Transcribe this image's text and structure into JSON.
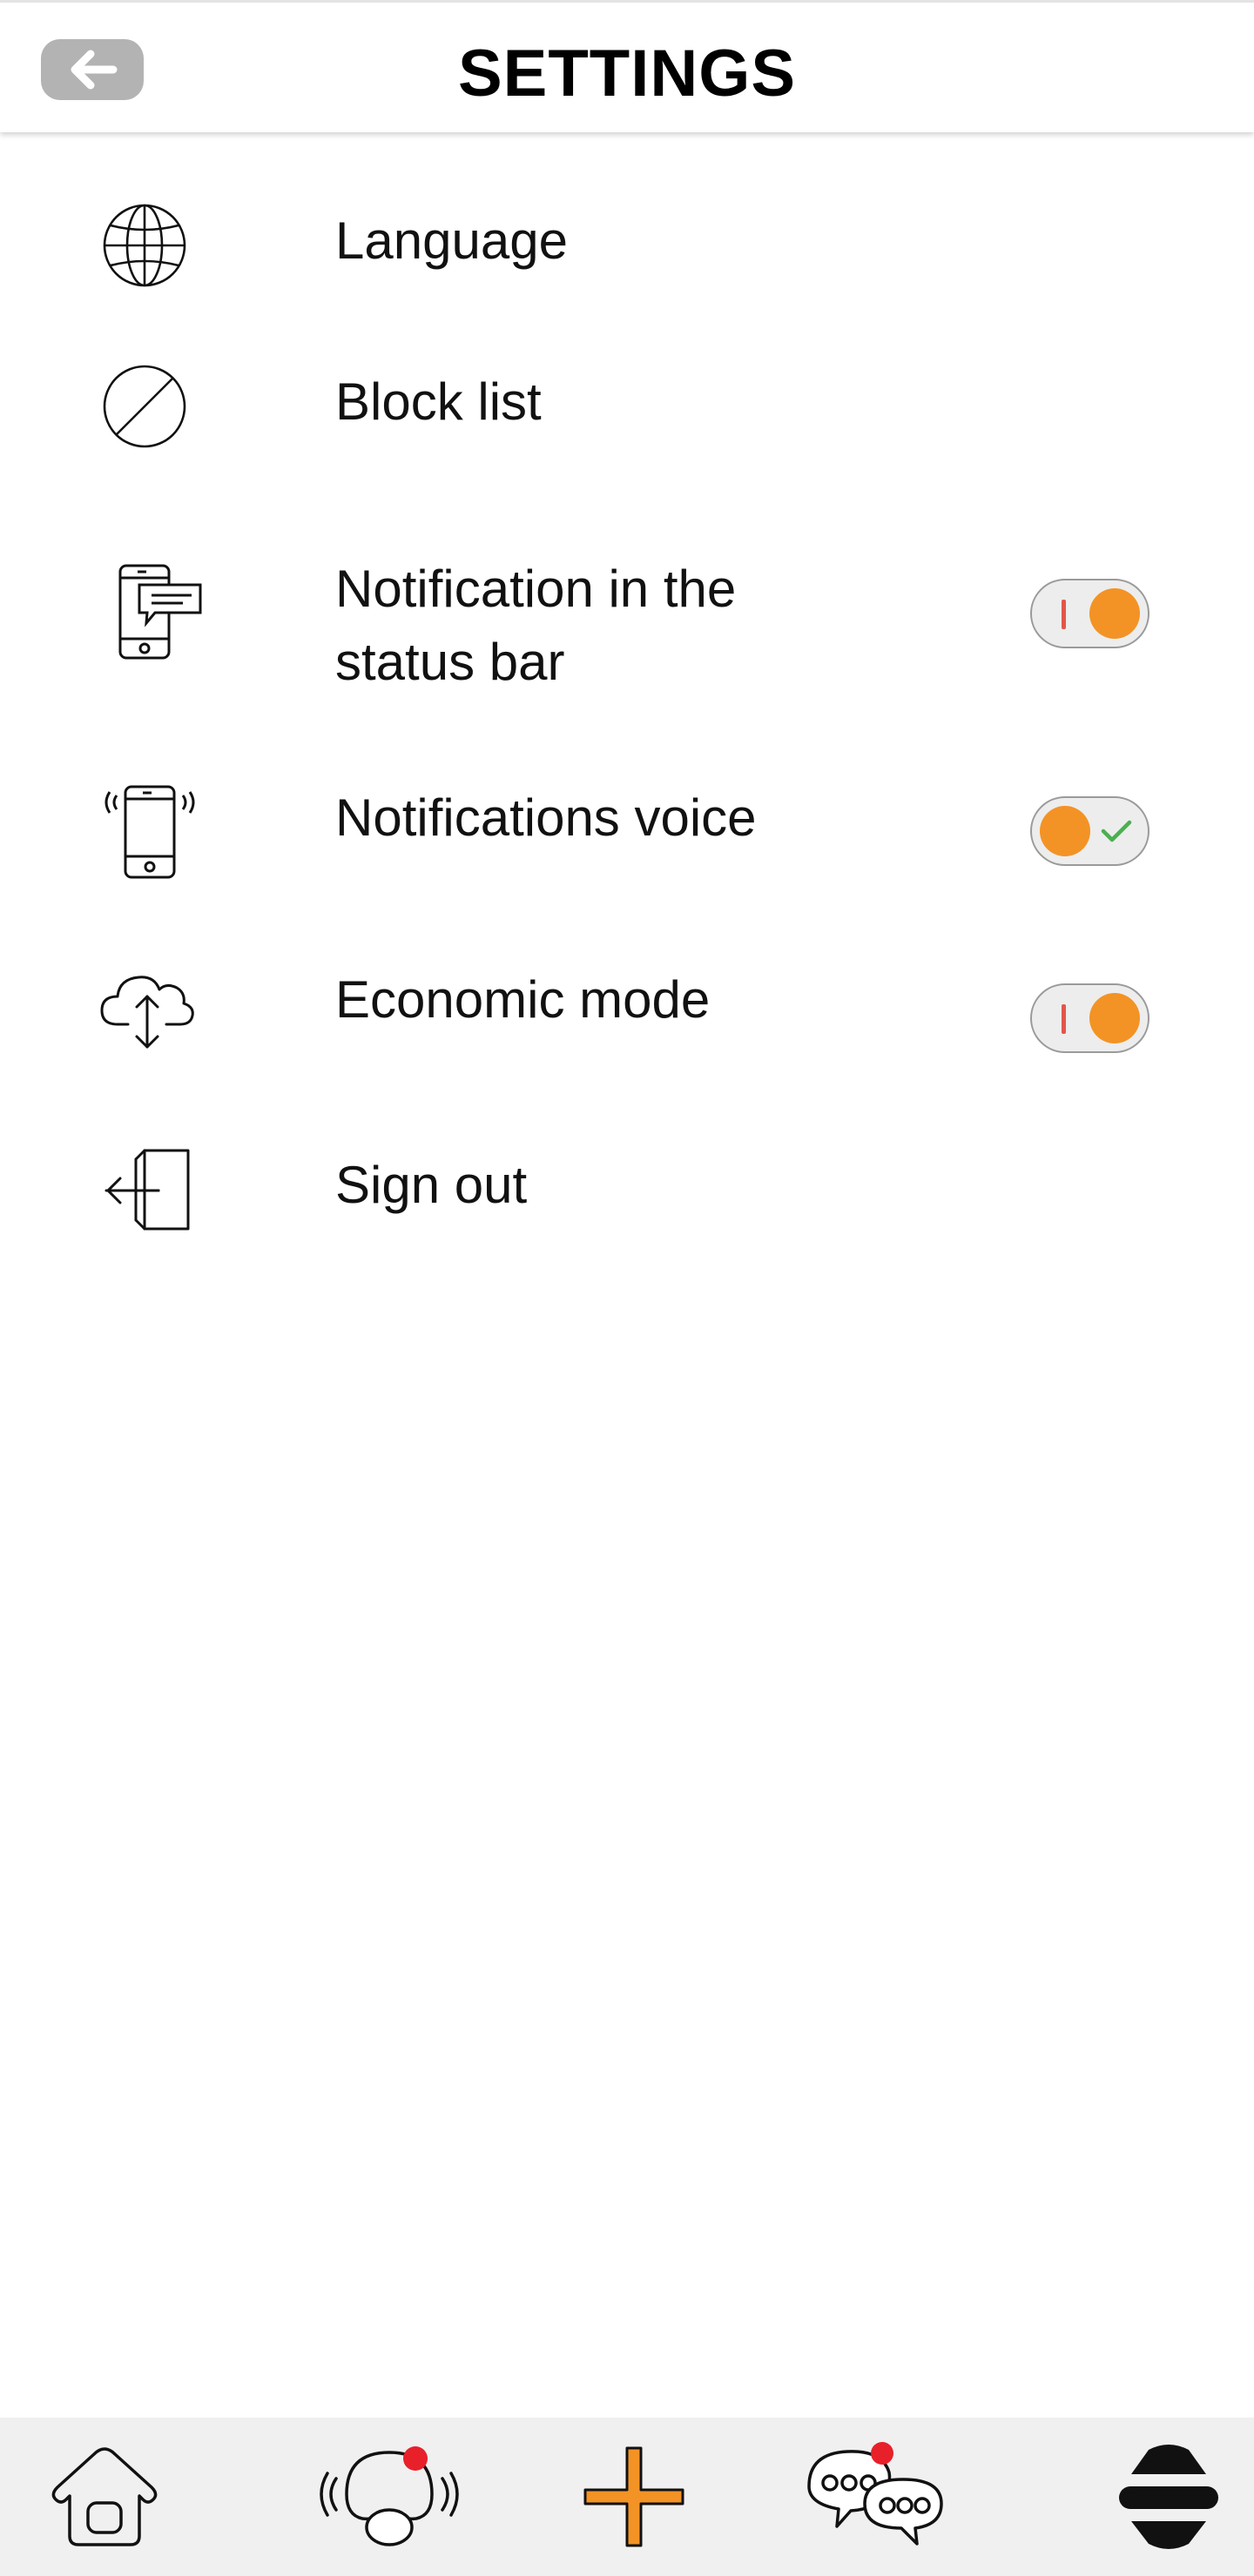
{
  "header": {
    "title": "SETTINGS",
    "back_icon": "arrow-left-icon"
  },
  "settings": {
    "items": [
      {
        "label": "Language",
        "icon": "globe-icon"
      },
      {
        "label": "Block list",
        "icon": "block-icon"
      },
      {
        "label": "Notification in the status bar",
        "icon": "phone-message-icon",
        "toggle": "off"
      },
      {
        "label": "Notifications voice",
        "icon": "phone-vibrate-icon",
        "toggle": "on"
      },
      {
        "label": "Economic mode",
        "icon": "cloud-sync-icon",
        "toggle": "off"
      },
      {
        "label": "Sign out",
        "icon": "sign-out-icon"
      }
    ]
  },
  "bottom_nav": {
    "items": [
      "home-icon",
      "nearby-people-icon",
      "add-icon",
      "chat-icon",
      "menu-icon"
    ]
  },
  "colors": {
    "accent": "#f39325",
    "toggle_off_mark": "#e4554a",
    "toggle_on_mark": "#4caf50",
    "notification_dot": "#e8202a",
    "nav_background": "#f0f0f0",
    "back_button": "#b3b3b3"
  }
}
